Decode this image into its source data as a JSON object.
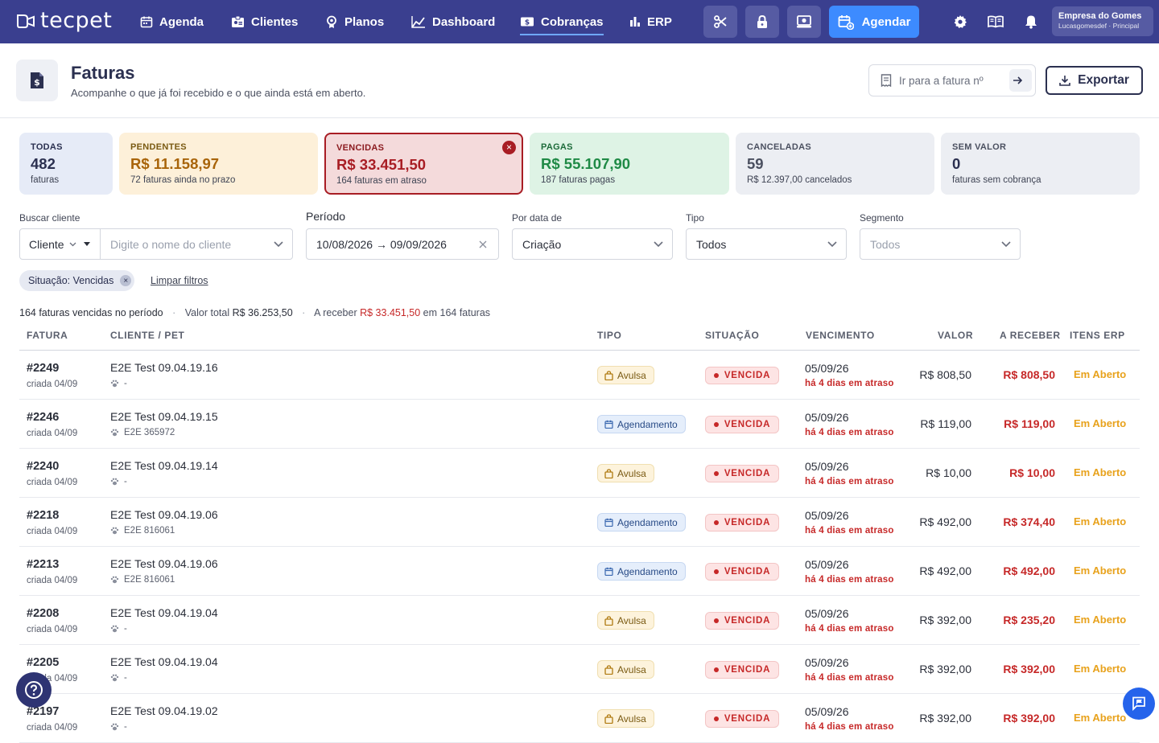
{
  "brand": {
    "logo": "tecpet"
  },
  "nav": {
    "items": [
      {
        "label": "Agenda",
        "icon": "calendar-icon"
      },
      {
        "label": "Clientes",
        "icon": "id-card-icon"
      },
      {
        "label": "Planos",
        "icon": "badge-icon"
      },
      {
        "label": "Dashboard",
        "icon": "chart-line-icon"
      },
      {
        "label": "Cobranças",
        "icon": "money-icon",
        "active": true
      },
      {
        "label": "ERP",
        "icon": "bar-chart-icon"
      }
    ],
    "agendar_label": "Agendar",
    "company_name": "Empresa do Gomes",
    "company_sub": "Lucasgomesdef · Principal"
  },
  "header": {
    "title": "Faturas",
    "subtitle": "Acompanhe o que já foi recebido e o que ainda está em aberto.",
    "goto_placeholder": "Ir para a fatura nº",
    "export_label": "Exportar"
  },
  "cards": [
    {
      "label": "TODAS",
      "value": "482",
      "sub": "faturas"
    },
    {
      "label": "PENDENTES",
      "value": "R$ 11.158,97",
      "sub": "72 faturas ainda no prazo"
    },
    {
      "label": "VENCIDAS",
      "value": "R$ 33.451,50",
      "sub": "164 faturas em atraso",
      "selected": true
    },
    {
      "label": "PAGAS",
      "value": "R$ 55.107,90",
      "sub": "187 faturas pagas"
    },
    {
      "label": "CANCELADAS",
      "value": "59",
      "sub": "R$ 12.397,00 cancelados"
    },
    {
      "label": "SEM VALOR",
      "value": "0",
      "sub": "faturas sem cobrança"
    }
  ],
  "filters": {
    "search_label": "Buscar cliente",
    "search_mode": "Cliente",
    "search_placeholder": "Digite o nome do cliente",
    "period_label": "Período",
    "period_value": "10/08/2026 → 09/09/2026",
    "date_by_label": "Por data de",
    "date_by_value": "Criação",
    "type_label": "Tipo",
    "type_value": "Todos",
    "segment_label": "Segmento",
    "segment_value": "Todos",
    "chip_key": "Situação:",
    "chip_value": "Vencidas",
    "clear_label": "Limpar filtros"
  },
  "summary": {
    "count_text": "164 faturas vencidas no período",
    "total_prefix": "Valor total",
    "total_value": "R$ 36.253,50",
    "receive_prefix": "A receber",
    "receive_value": "R$ 33.451,50",
    "receive_suffix": "em 164 faturas"
  },
  "table": {
    "headers": [
      "FATURA",
      "CLIENTE / PET",
      "TIPO",
      "SITUAÇÃO",
      "VENCIMENTO",
      "VALOR",
      "A RECEBER",
      "ITENS ERP"
    ],
    "rows": [
      {
        "id": "#2249",
        "created": "criada 04/09",
        "client": "E2E Test 09.04.19.16",
        "pet": "-",
        "type": "Avulsa",
        "status": "VENCIDA",
        "due": "05/09/26",
        "late": "há 4 dias em atraso",
        "value": "R$ 808,50",
        "receive": "R$ 808,50",
        "erp": "Em Aberto"
      },
      {
        "id": "#2246",
        "created": "criada 04/09",
        "client": "E2E Test 09.04.19.15",
        "pet": "E2E 365972",
        "type": "Agendamento",
        "status": "VENCIDA",
        "due": "05/09/26",
        "late": "há 4 dias em atraso",
        "value": "R$ 119,00",
        "receive": "R$ 119,00",
        "erp": "Em Aberto"
      },
      {
        "id": "#2240",
        "created": "criada 04/09",
        "client": "E2E Test 09.04.19.14",
        "pet": "-",
        "type": "Avulsa",
        "status": "VENCIDA",
        "due": "05/09/26",
        "late": "há 4 dias em atraso",
        "value": "R$ 10,00",
        "receive": "R$ 10,00",
        "erp": "Em Aberto"
      },
      {
        "id": "#2218",
        "created": "criada 04/09",
        "client": "E2E Test 09.04.19.06",
        "pet": "E2E 816061",
        "type": "Agendamento",
        "status": "VENCIDA",
        "due": "05/09/26",
        "late": "há 4 dias em atraso",
        "value": "R$ 492,00",
        "receive": "R$ 374,40",
        "erp": "Em Aberto"
      },
      {
        "id": "#2213",
        "created": "criada 04/09",
        "client": "E2E Test 09.04.19.06",
        "pet": "E2E 816061",
        "type": "Agendamento",
        "status": "VENCIDA",
        "due": "05/09/26",
        "late": "há 4 dias em atraso",
        "value": "R$ 492,00",
        "receive": "R$ 492,00",
        "erp": "Em Aberto"
      },
      {
        "id": "#2208",
        "created": "criada 04/09",
        "client": "E2E Test 09.04.19.04",
        "pet": "-",
        "type": "Avulsa",
        "status": "VENCIDA",
        "due": "05/09/26",
        "late": "há 4 dias em atraso",
        "value": "R$ 392,00",
        "receive": "R$ 235,20",
        "erp": "Em Aberto"
      },
      {
        "id": "#2205",
        "created": "criada 04/09",
        "client": "E2E Test 09.04.19.04",
        "pet": "-",
        "type": "Avulsa",
        "status": "VENCIDA",
        "due": "05/09/26",
        "late": "há 4 dias em atraso",
        "value": "R$ 392,00",
        "receive": "R$ 392,00",
        "erp": "Em Aberto"
      },
      {
        "id": "#2197",
        "created": "criada 04/09",
        "client": "E2E Test 09.04.19.02",
        "pet": "-",
        "type": "Avulsa",
        "status": "VENCIDA",
        "due": "05/09/26",
        "late": "há 4 dias em atraso",
        "value": "R$ 392,00",
        "receive": "R$ 392,00",
        "erp": "Em Aberto"
      }
    ]
  },
  "colors": {
    "nav_bg": "#3a3f8f",
    "accent": "#3d8bff",
    "overdue": "#c62828",
    "erp_open": "#e8a21c"
  }
}
